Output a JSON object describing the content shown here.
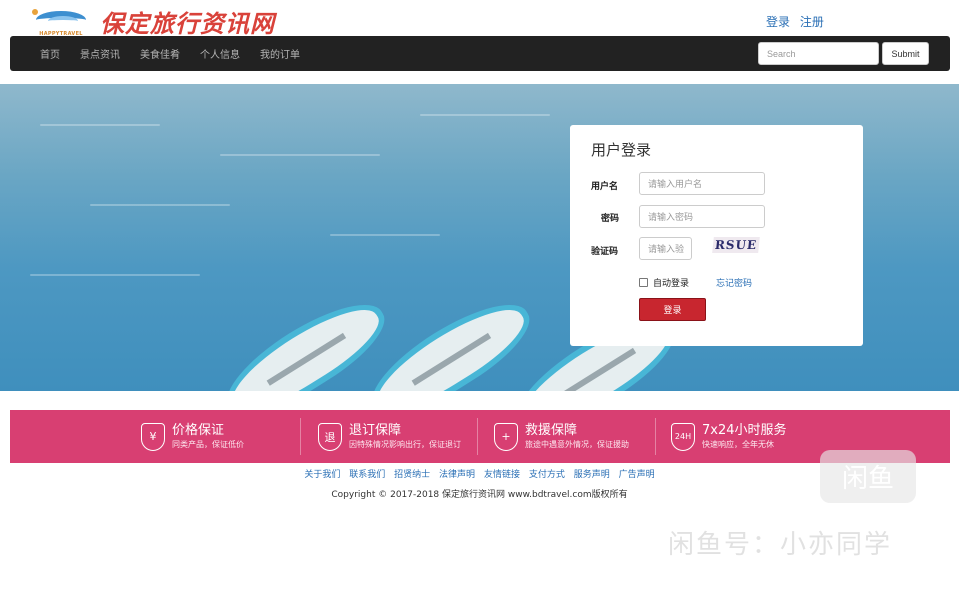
{
  "header": {
    "logo_brand": "HAPPYTRAVEL",
    "site_title": "保定旅行资讯网",
    "login_link": "登录",
    "register_link": "注册"
  },
  "navbar": {
    "items": [
      "首页",
      "景点资讯",
      "美食佳肴",
      "个人信息",
      "我的订单"
    ],
    "search_placeholder": "Search",
    "submit_label": "Submit"
  },
  "login": {
    "title": "用户登录",
    "username_label": "用户名",
    "username_placeholder": "请输入用户名",
    "password_label": "密码",
    "password_placeholder": "请输入密码",
    "captcha_label": "验证码",
    "captcha_placeholder": "请输入验",
    "captcha_image_text": "RSUE",
    "remember_label": "自动登录",
    "forgot_link": "忘记密码",
    "submit_label": "登录"
  },
  "guarantees": [
    {
      "icon_text": "¥",
      "title": "价格保证",
      "subtitle": "同类产品，保证低价"
    },
    {
      "icon_text": "退",
      "title": "退订保障",
      "subtitle": "因特殊情况影响出行，保证退订"
    },
    {
      "icon_text": "+",
      "title": "救援保障",
      "subtitle": "旅途中遇意外情况，保证援助"
    },
    {
      "icon_text": "24H",
      "title": "7x24小时服务",
      "subtitle": "快速响应，全年无休"
    }
  ],
  "footer": {
    "links": [
      "关于我们",
      "联系我们",
      "招贤纳士",
      "法律声明",
      "友情链接",
      "支付方式",
      "服务声明",
      "广告声明"
    ],
    "copyright": "Copyright © 2017-2018 保定旅行资讯网 www.bdtravel.com版权所有"
  },
  "watermark": {
    "logo_text": "闲鱼",
    "text": "闲鱼号：小亦同学"
  },
  "colors": {
    "navbar_bg": "#222222",
    "link_blue": "#2a6fb5",
    "login_button": "#c8262f",
    "band_pink": "#d83f72"
  }
}
